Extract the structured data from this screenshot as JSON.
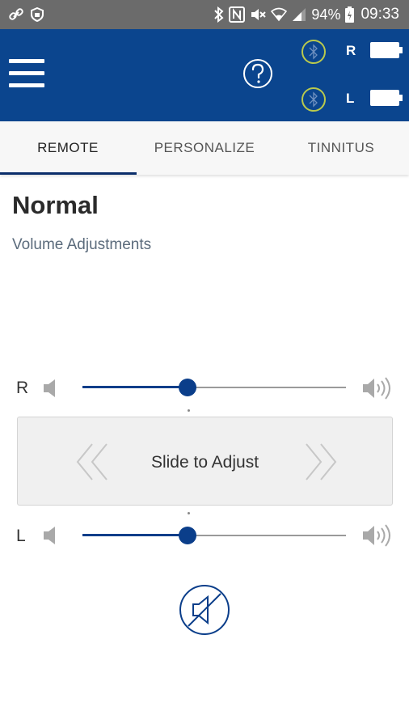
{
  "status_bar": {
    "battery_percent": "94%",
    "time": "09:33"
  },
  "header": {
    "devices": [
      {
        "side": "R",
        "connected": true,
        "battery_level": 1.0
      },
      {
        "side": "L",
        "connected": true,
        "battery_level": 1.0
      }
    ]
  },
  "tabs": [
    {
      "label": "REMOTE",
      "active": true
    },
    {
      "label": "PERSONALIZE",
      "active": false
    },
    {
      "label": "TINNITUS",
      "active": false
    }
  ],
  "program": {
    "title": "Normal",
    "subtitle": "Volume Adjustments"
  },
  "volume": {
    "right": {
      "label": "R",
      "level": 0.4
    },
    "left": {
      "label": "L",
      "level": 0.4
    }
  },
  "adjust_panel": {
    "label": "Slide to Adjust"
  },
  "colors": {
    "brand": "#0b458e",
    "accent": "#0b3e8a",
    "status_bar": "#6b6b6b",
    "bluetooth_ring": "#b9c94d"
  },
  "icons": {
    "menu": "menu-icon",
    "help": "help-icon",
    "bluetooth": "bluetooth-icon",
    "battery": "battery-icon",
    "speaker_low": "speaker-low-icon",
    "speaker_high": "speaker-high-icon",
    "mute": "mute-icon",
    "chevron_left": "double-chevron-left-icon",
    "chevron_right": "double-chevron-right-icon"
  }
}
